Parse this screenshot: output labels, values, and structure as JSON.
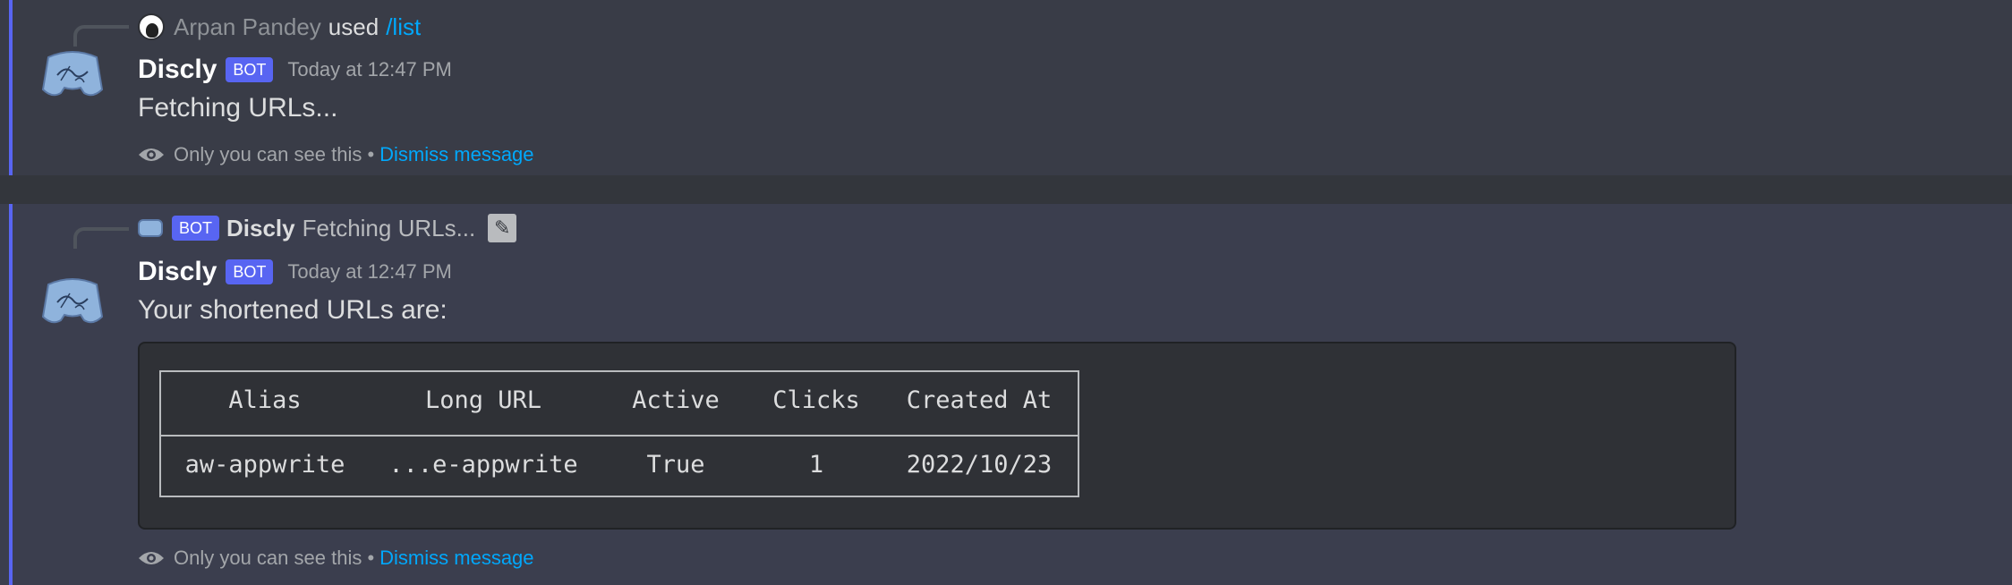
{
  "messages": [
    {
      "reply": {
        "user_name": "Arpan Pandey",
        "used_text": "used",
        "command": "/list"
      },
      "author": "Discly",
      "bot_tag": "BOT",
      "timestamp": "Today at 12:47 PM",
      "content": "Fetching URLs...",
      "ephemeral_text": "Only you can see this •",
      "dismiss_label": "Dismiss message"
    },
    {
      "reply": {
        "bot_tag": "BOT",
        "author": "Discly",
        "text": "Fetching URLs..."
      },
      "author": "Discly",
      "bot_tag": "BOT",
      "timestamp": "Today at 12:47 PM",
      "content": "Your shortened URLs are:",
      "table": {
        "headers": [
          "Alias",
          "Long URL",
          "Active",
          "Clicks",
          "Created At"
        ],
        "rows": [
          [
            "aw-appwrite",
            "...e-appwrite",
            "True",
            "1",
            "2022/10/23"
          ]
        ]
      },
      "ephemeral_text": "Only you can see this •",
      "dismiss_label": "Dismiss message"
    }
  ],
  "colors": {
    "accent": "#5865f2",
    "link": "#00a8fc",
    "background": "#36393f"
  },
  "icons": [
    "eye-icon",
    "edit-icon",
    "bot-avatar-icon",
    "user-avatar-icon"
  ]
}
